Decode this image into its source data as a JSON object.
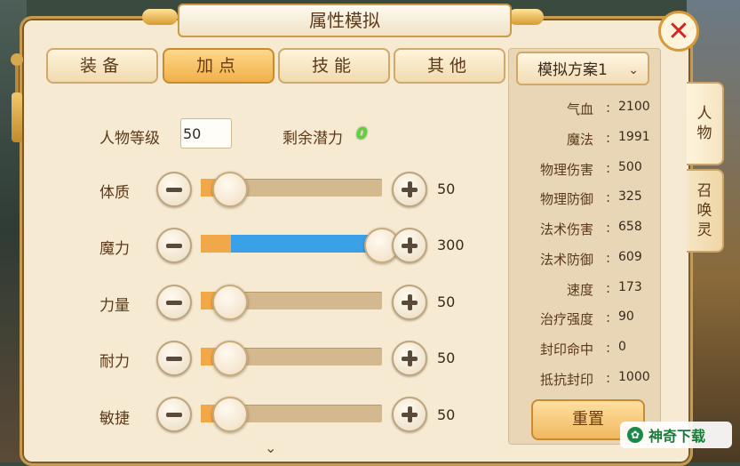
{
  "window": {
    "title": "属性模拟",
    "close_icon": "close-icon"
  },
  "tabs": [
    {
      "label": "装备",
      "active": false
    },
    {
      "label": "加点",
      "active": true
    },
    {
      "label": "技能",
      "active": false
    },
    {
      "label": "其他",
      "active": false
    }
  ],
  "level": {
    "label": "人物等级",
    "value": "50"
  },
  "remaining": {
    "label": "剩余潜力",
    "value": "0"
  },
  "attributes": [
    {
      "label": "体质",
      "value": "50",
      "slider_fraction": 0.1
    },
    {
      "label": "魔力",
      "value": "300",
      "slider_fraction": 1.0
    },
    {
      "label": "力量",
      "value": "50",
      "slider_fraction": 0.1
    },
    {
      "label": "耐力",
      "value": "50",
      "slider_fraction": 0.1
    },
    {
      "label": "敏捷",
      "value": "50",
      "slider_fraction": 0.1
    }
  ],
  "scheme": {
    "label": "模拟方案1"
  },
  "stats": [
    {
      "name": "气血",
      "value": "2100"
    },
    {
      "name": "魔法",
      "value": "1991"
    },
    {
      "name": "物理伤害",
      "value": "500"
    },
    {
      "name": "物理防御",
      "value": "325"
    },
    {
      "name": "法术伤害",
      "value": "658"
    },
    {
      "name": "法术防御",
      "value": "609"
    },
    {
      "name": "速度",
      "value": "173"
    },
    {
      "name": "治疗强度",
      "value": "90"
    },
    {
      "name": "封印命中",
      "value": "0"
    },
    {
      "name": "抵抗封印",
      "value": "1000"
    }
  ],
  "side_tabs": [
    {
      "label": "人物",
      "active": true
    },
    {
      "label": "召唤灵",
      "active": false
    }
  ],
  "reset_button": {
    "label": "重置"
  },
  "watermark": {
    "text": "神奇下载"
  },
  "colors": {
    "slider_fill": "#f0a848",
    "magic_fill": "#3aa0e8",
    "remaining_value": "#5ad63a"
  }
}
